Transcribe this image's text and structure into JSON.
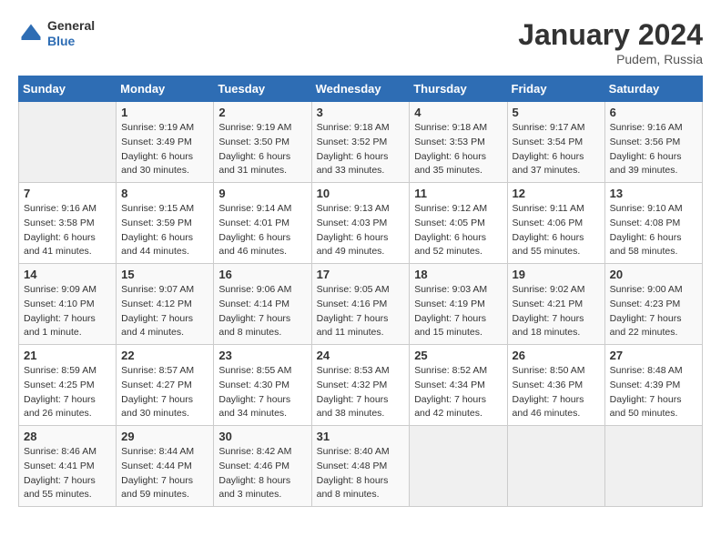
{
  "header": {
    "logo_general": "General",
    "logo_blue": "Blue",
    "month_title": "January 2024",
    "location": "Pudem, Russia"
  },
  "days_of_week": [
    "Sunday",
    "Monday",
    "Tuesday",
    "Wednesday",
    "Thursday",
    "Friday",
    "Saturday"
  ],
  "weeks": [
    [
      {
        "day": "",
        "sunrise": "",
        "sunset": "",
        "daylight": ""
      },
      {
        "day": "1",
        "sunrise": "9:19 AM",
        "sunset": "3:49 PM",
        "daylight": "6 hours and 30 minutes."
      },
      {
        "day": "2",
        "sunrise": "9:19 AM",
        "sunset": "3:50 PM",
        "daylight": "6 hours and 31 minutes."
      },
      {
        "day": "3",
        "sunrise": "9:18 AM",
        "sunset": "3:52 PM",
        "daylight": "6 hours and 33 minutes."
      },
      {
        "day": "4",
        "sunrise": "9:18 AM",
        "sunset": "3:53 PM",
        "daylight": "6 hours and 35 minutes."
      },
      {
        "day": "5",
        "sunrise": "9:17 AM",
        "sunset": "3:54 PM",
        "daylight": "6 hours and 37 minutes."
      },
      {
        "day": "6",
        "sunrise": "9:16 AM",
        "sunset": "3:56 PM",
        "daylight": "6 hours and 39 minutes."
      }
    ],
    [
      {
        "day": "7",
        "sunrise": "9:16 AM",
        "sunset": "3:58 PM",
        "daylight": "6 hours and 41 minutes."
      },
      {
        "day": "8",
        "sunrise": "9:15 AM",
        "sunset": "3:59 PM",
        "daylight": "6 hours and 44 minutes."
      },
      {
        "day": "9",
        "sunrise": "9:14 AM",
        "sunset": "4:01 PM",
        "daylight": "6 hours and 46 minutes."
      },
      {
        "day": "10",
        "sunrise": "9:13 AM",
        "sunset": "4:03 PM",
        "daylight": "6 hours and 49 minutes."
      },
      {
        "day": "11",
        "sunrise": "9:12 AM",
        "sunset": "4:05 PM",
        "daylight": "6 hours and 52 minutes."
      },
      {
        "day": "12",
        "sunrise": "9:11 AM",
        "sunset": "4:06 PM",
        "daylight": "6 hours and 55 minutes."
      },
      {
        "day": "13",
        "sunrise": "9:10 AM",
        "sunset": "4:08 PM",
        "daylight": "6 hours and 58 minutes."
      }
    ],
    [
      {
        "day": "14",
        "sunrise": "9:09 AM",
        "sunset": "4:10 PM",
        "daylight": "7 hours and 1 minute."
      },
      {
        "day": "15",
        "sunrise": "9:07 AM",
        "sunset": "4:12 PM",
        "daylight": "7 hours and 4 minutes."
      },
      {
        "day": "16",
        "sunrise": "9:06 AM",
        "sunset": "4:14 PM",
        "daylight": "7 hours and 8 minutes."
      },
      {
        "day": "17",
        "sunrise": "9:05 AM",
        "sunset": "4:16 PM",
        "daylight": "7 hours and 11 minutes."
      },
      {
        "day": "18",
        "sunrise": "9:03 AM",
        "sunset": "4:19 PM",
        "daylight": "7 hours and 15 minutes."
      },
      {
        "day": "19",
        "sunrise": "9:02 AM",
        "sunset": "4:21 PM",
        "daylight": "7 hours and 18 minutes."
      },
      {
        "day": "20",
        "sunrise": "9:00 AM",
        "sunset": "4:23 PM",
        "daylight": "7 hours and 22 minutes."
      }
    ],
    [
      {
        "day": "21",
        "sunrise": "8:59 AM",
        "sunset": "4:25 PM",
        "daylight": "7 hours and 26 minutes."
      },
      {
        "day": "22",
        "sunrise": "8:57 AM",
        "sunset": "4:27 PM",
        "daylight": "7 hours and 30 minutes."
      },
      {
        "day": "23",
        "sunrise": "8:55 AM",
        "sunset": "4:30 PM",
        "daylight": "7 hours and 34 minutes."
      },
      {
        "day": "24",
        "sunrise": "8:53 AM",
        "sunset": "4:32 PM",
        "daylight": "7 hours and 38 minutes."
      },
      {
        "day": "25",
        "sunrise": "8:52 AM",
        "sunset": "4:34 PM",
        "daylight": "7 hours and 42 minutes."
      },
      {
        "day": "26",
        "sunrise": "8:50 AM",
        "sunset": "4:36 PM",
        "daylight": "7 hours and 46 minutes."
      },
      {
        "day": "27",
        "sunrise": "8:48 AM",
        "sunset": "4:39 PM",
        "daylight": "7 hours and 50 minutes."
      }
    ],
    [
      {
        "day": "28",
        "sunrise": "8:46 AM",
        "sunset": "4:41 PM",
        "daylight": "7 hours and 55 minutes."
      },
      {
        "day": "29",
        "sunrise": "8:44 AM",
        "sunset": "4:44 PM",
        "daylight": "7 hours and 59 minutes."
      },
      {
        "day": "30",
        "sunrise": "8:42 AM",
        "sunset": "4:46 PM",
        "daylight": "8 hours and 3 minutes."
      },
      {
        "day": "31",
        "sunrise": "8:40 AM",
        "sunset": "4:48 PM",
        "daylight": "8 hours and 8 minutes."
      },
      {
        "day": "",
        "sunrise": "",
        "sunset": "",
        "daylight": ""
      },
      {
        "day": "",
        "sunrise": "",
        "sunset": "",
        "daylight": ""
      },
      {
        "day": "",
        "sunrise": "",
        "sunset": "",
        "daylight": ""
      }
    ]
  ]
}
